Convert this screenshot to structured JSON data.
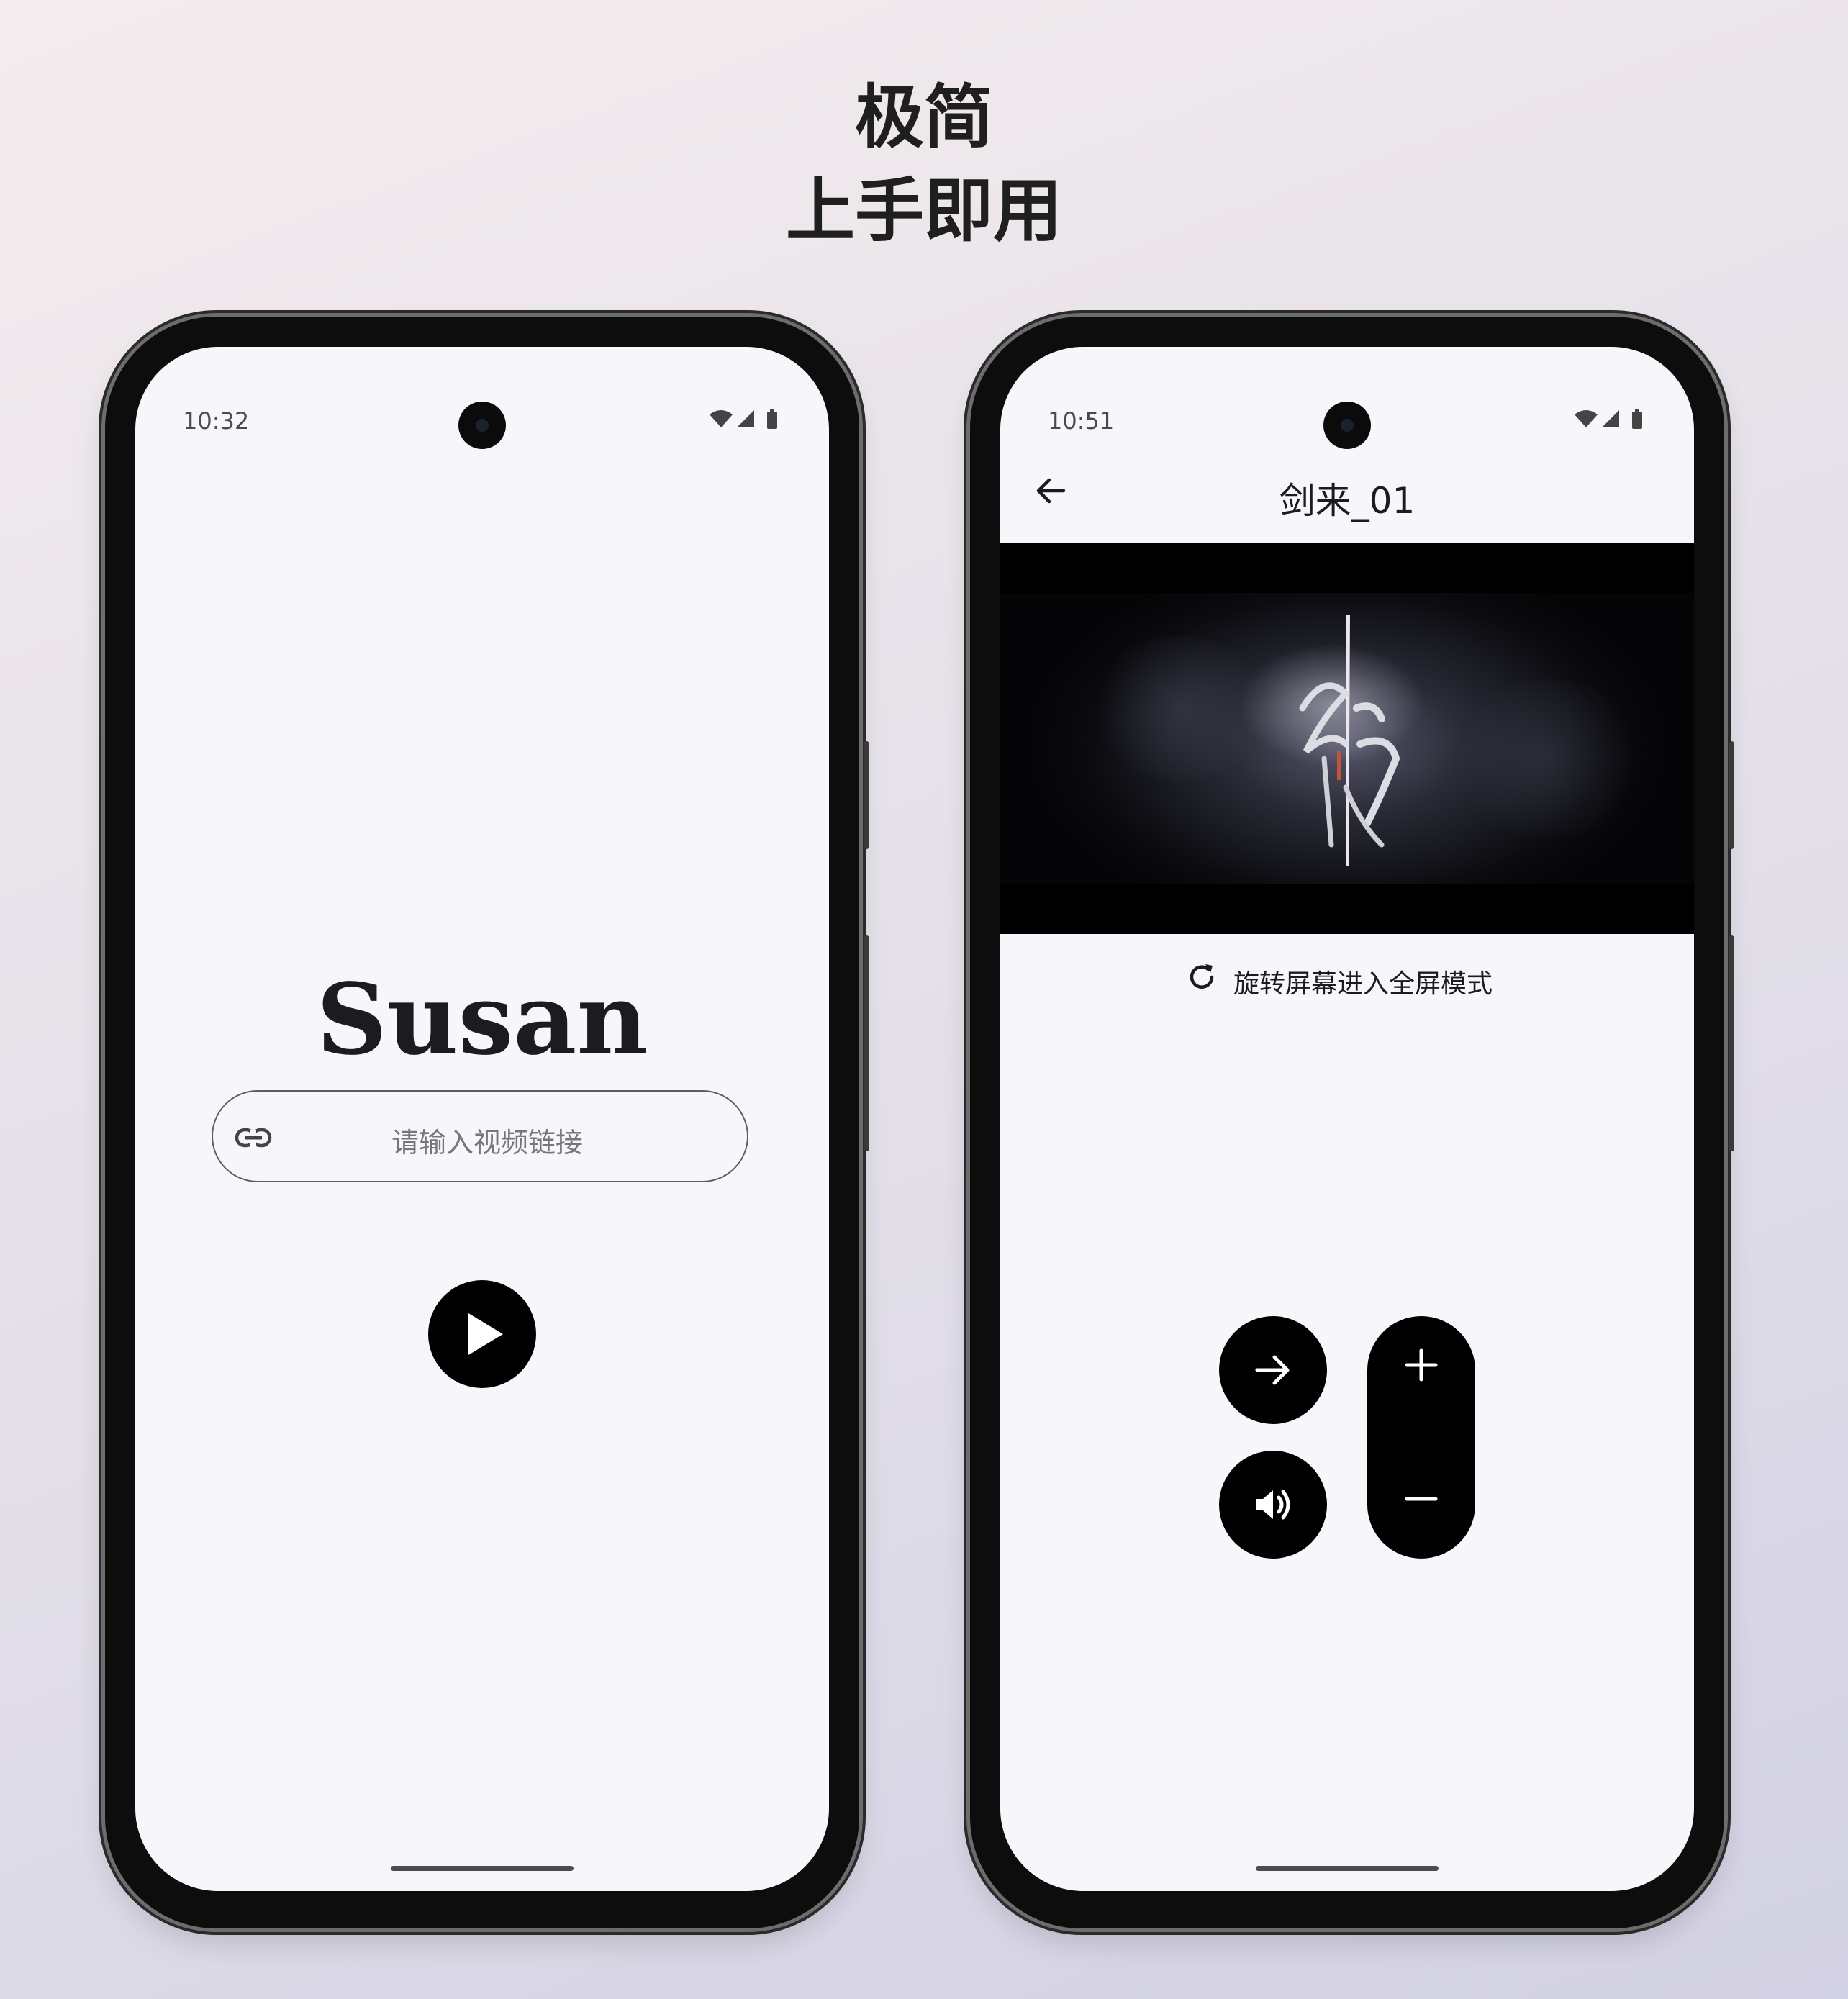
{
  "headline": {
    "line1": "极简",
    "line2": "上手即用"
  },
  "left_phone": {
    "status_time": "10:32",
    "app_title": "Susan",
    "url_input": {
      "placeholder": "请输入视频链接",
      "icon": "link-icon"
    },
    "play_button": {
      "icon": "play-icon"
    }
  },
  "right_phone": {
    "status_time": "10:51",
    "back_icon": "arrow-left-icon",
    "video_title": "剑来_01",
    "rotate_hint": "旋转屏幕进入全屏模式",
    "controls": {
      "forward": "arrow-right-icon",
      "volume": "volume-icon",
      "volume_up": "plus-icon",
      "volume_down": "minus-icon"
    }
  },
  "colors": {
    "screen_bg": "#f7f7fb",
    "button_bg": "#000000",
    "text": "#1c1b1f"
  }
}
